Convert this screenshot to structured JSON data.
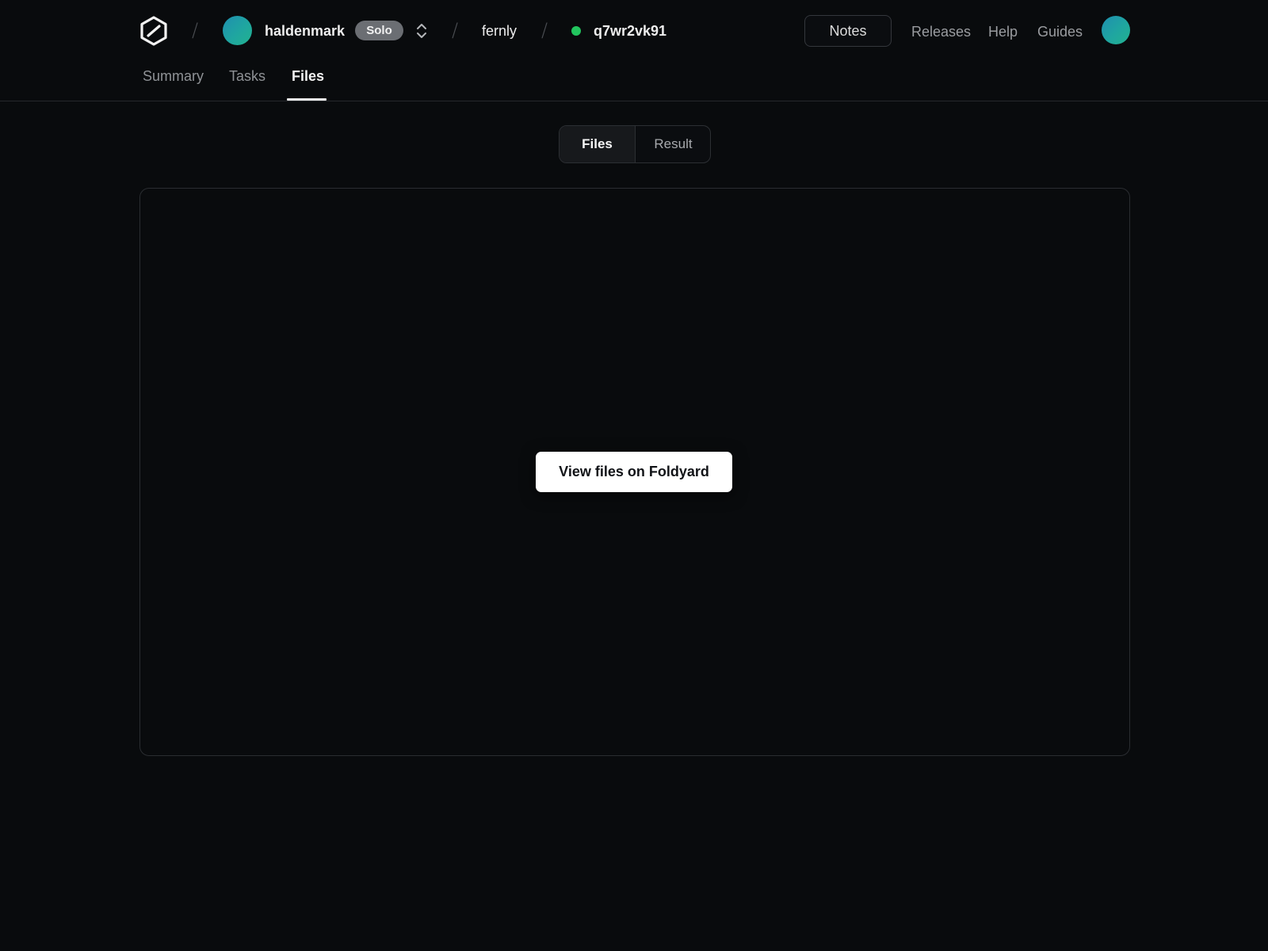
{
  "header": {
    "team_name": "haldenmark",
    "plan_badge": "Solo",
    "project_name": "fernly",
    "deployment_id": "q7wr2vk91",
    "deployment_status_color": "#22c55e",
    "separator": "/",
    "notes_label": "Notes",
    "links": [
      "Releases",
      "Help",
      "Guides"
    ]
  },
  "tabs": [
    "Summary",
    "Tasks",
    "Files"
  ],
  "active_tab": "Files",
  "segmented": {
    "items": [
      "Files",
      "Result"
    ],
    "active": "Files"
  },
  "panel": {
    "button_label": "View files on Foldyard"
  }
}
